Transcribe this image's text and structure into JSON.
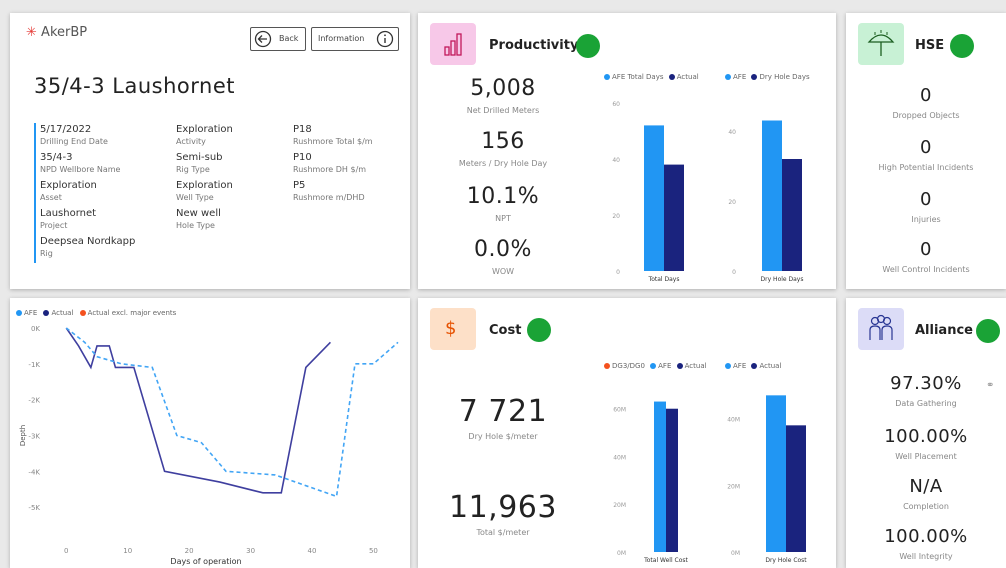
{
  "colors": {
    "afe": "#2196f3",
    "actual": "#1a237e",
    "dgo": "#f4511e",
    "green": "#1aa336",
    "pink": "#f7c8e8",
    "greenBadge": "#c8f1d5",
    "orange": "#fde0c8",
    "lavender": "#dcdcf7"
  },
  "header": {
    "logo": "AkerBP",
    "back_label": "Back",
    "info_label": "Information",
    "title": "35/4-3 Laushornet"
  },
  "details": {
    "col1": [
      {
        "value": "5/17/2022",
        "label": "Drilling End Date"
      },
      {
        "value": "35/4-3",
        "label": "NPD Wellbore Name"
      },
      {
        "value": "Exploration",
        "label": "Asset"
      },
      {
        "value": "Laushornet",
        "label": "Project"
      },
      {
        "value": "Deepsea Nordkapp",
        "label": "Rig"
      }
    ],
    "col2": [
      {
        "value": "Exploration",
        "label": "Activity"
      },
      {
        "value": "Semi-sub",
        "label": "Rig Type"
      },
      {
        "value": "Exploration",
        "label": "Well Type"
      },
      {
        "value": "New well",
        "label": "Hole Type"
      }
    ],
    "col3": [
      {
        "value": "P18",
        "label": "Rushmore Total $/m"
      },
      {
        "value": "P10",
        "label": "Rushmore DH $/m"
      },
      {
        "value": "P5",
        "label": "Rushmore m/DHD"
      }
    ]
  },
  "productivity": {
    "title": "Productivity",
    "icon": "bar-chart-icon",
    "kpis": [
      {
        "value": "5,008",
        "label": "Net Drilled Meters"
      },
      {
        "value": "156",
        "label": "Meters / Dry Hole Day"
      },
      {
        "value": "10.1%",
        "label": "NPT"
      },
      {
        "value": "0.0%",
        "label": "WOW"
      }
    ]
  },
  "hse": {
    "title": "HSE",
    "icon": "umbrella-icon",
    "kpis": [
      {
        "value": "0",
        "label": "Dropped Objects"
      },
      {
        "value": "0",
        "label": "High Potential Incidents"
      },
      {
        "value": "0",
        "label": "Injuries"
      },
      {
        "value": "0",
        "label": "Well Control Incidents"
      }
    ]
  },
  "cost": {
    "title": "Cost",
    "icon": "dollar-icon",
    "kpis": [
      {
        "value": "7 721",
        "label": "Dry Hole $/meter"
      },
      {
        "value": "11,963",
        "label": "Total $/meter"
      }
    ]
  },
  "alliance": {
    "title": "Alliance",
    "icon": "people-icon",
    "kpis": [
      {
        "value": "97.30%",
        "label": "Data Gathering"
      },
      {
        "value": "100.00%",
        "label": "Well Placement"
      },
      {
        "value": "N/A",
        "label": "Completion"
      },
      {
        "value": "100.00%",
        "label": "Well Integrity"
      }
    ]
  },
  "chart_data": [
    {
      "id": "depth",
      "type": "line",
      "xlabel": "Days of operation",
      "ylabel": "Depth",
      "xlim": [
        -2,
        54
      ],
      "ylim": [
        -6000,
        0
      ],
      "xticks": [
        0,
        10,
        20,
        30,
        40,
        50
      ],
      "yticks": [
        0,
        -1000,
        -2000,
        -3000,
        -4000,
        -5000
      ],
      "ytick_labels": [
        "0K",
        "-1K",
        "-2K",
        "-3K",
        "-4K",
        "-5K"
      ],
      "legend": [
        "AFE",
        "Actual",
        "Actual excl. major events"
      ],
      "series": [
        {
          "name": "Actual",
          "x": [
            0,
            2,
            4,
            5,
            7,
            8,
            11,
            16,
            25,
            32,
            35,
            39,
            43
          ],
          "y": [
            0,
            -500,
            -1100,
            -500,
            -500,
            -1100,
            -1100,
            -4000,
            -4300,
            -4600,
            -4600,
            -1100,
            -400
          ]
        },
        {
          "name": "AFE",
          "x": [
            0,
            3,
            5,
            9,
            14,
            18,
            22,
            26,
            34,
            44,
            47,
            50,
            54
          ],
          "y": [
            0,
            -400,
            -800,
            -1000,
            -1100,
            -3000,
            -3200,
            -4000,
            -4100,
            -4700,
            -1000,
            -1000,
            -400
          ]
        }
      ]
    },
    {
      "id": "prod-days",
      "type": "bar",
      "legend": [
        "AFE Total Days",
        "Actual"
      ],
      "categories": [
        "Total Days"
      ],
      "yticks": [
        0,
        20,
        40,
        60
      ],
      "ylim": [
        0,
        60
      ],
      "series": [
        {
          "name": "AFE Total Days",
          "values": [
            52
          ]
        },
        {
          "name": "Actual",
          "values": [
            38
          ]
        }
      ]
    },
    {
      "id": "prod-dryhole",
      "type": "bar",
      "legend": [
        "AFE",
        "Dry Hole Days"
      ],
      "categories": [
        "Dry Hole Days"
      ],
      "yticks": [
        0,
        20,
        40
      ],
      "ylim": [
        0,
        48
      ],
      "series": [
        {
          "name": "AFE",
          "values": [
            43
          ]
        },
        {
          "name": "Dry Hole Days",
          "values": [
            32
          ]
        }
      ]
    },
    {
      "id": "cost-total",
      "type": "bar",
      "legend": [
        "DG3/DG0",
        "AFE",
        "Actual"
      ],
      "categories": [
        "Total Well Cost"
      ],
      "yticks": [
        0,
        20,
        40,
        60
      ],
      "ytick_labels": [
        "0M",
        "20M",
        "40M",
        "60M"
      ],
      "ylim": [
        0,
        67
      ],
      "series": [
        {
          "name": "AFE",
          "values": [
            63
          ]
        },
        {
          "name": "Actual",
          "values": [
            60
          ]
        }
      ]
    },
    {
      "id": "cost-dryhole",
      "type": "bar",
      "legend": [
        "AFE",
        "Actual"
      ],
      "categories": [
        "Dry Hole Cost"
      ],
      "yticks": [
        0,
        20,
        40
      ],
      "ytick_labels": [
        "0M",
        "20M",
        "40M"
      ],
      "ylim": [
        0,
        48
      ],
      "series": [
        {
          "name": "AFE",
          "values": [
            47
          ]
        },
        {
          "name": "Actual",
          "values": [
            38
          ]
        }
      ]
    }
  ]
}
